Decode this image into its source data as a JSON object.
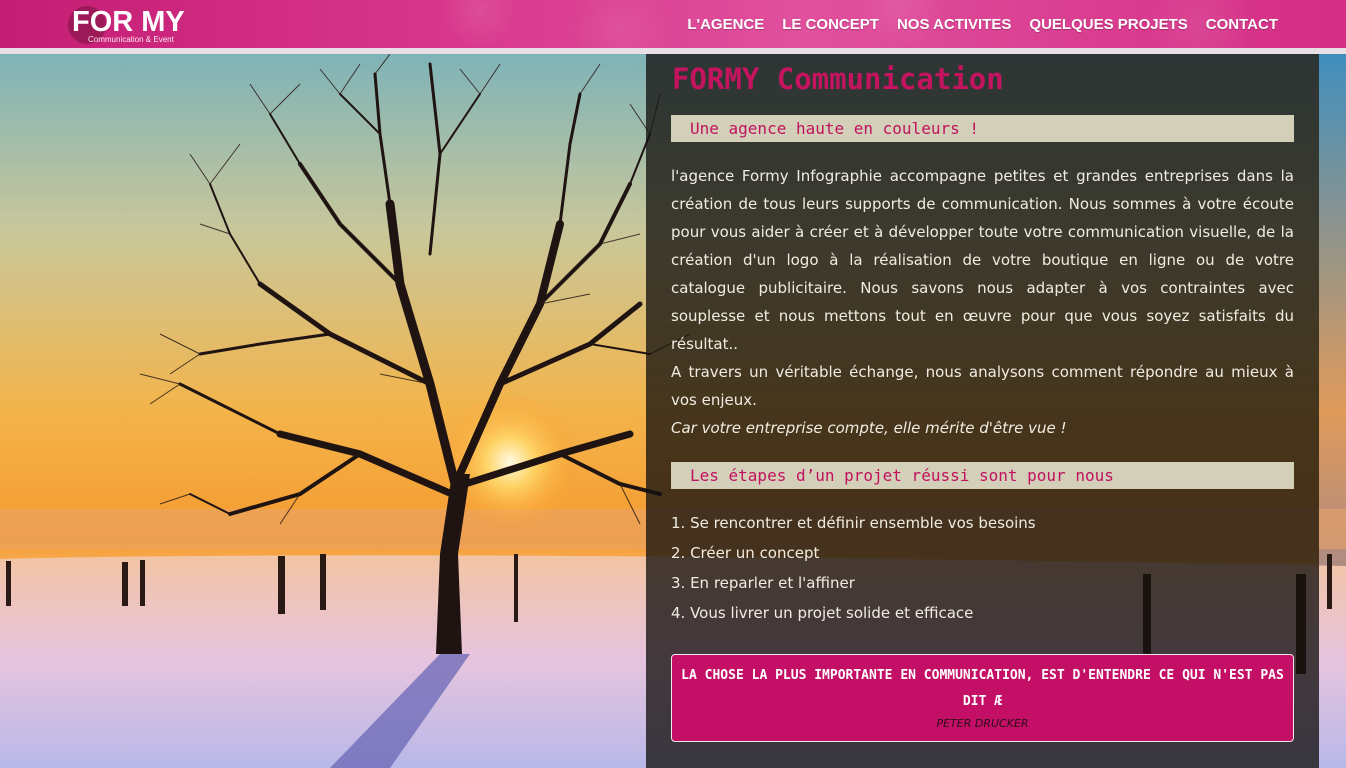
{
  "header": {
    "logo_text": "FOR MY",
    "logo_subtitle": "Communication & Event",
    "nav": [
      {
        "label": "L'AGENCE"
      },
      {
        "label": "LE CONCEPT"
      },
      {
        "label": "NOS ACTIVITES"
      },
      {
        "label": "QUELQUES PROJETS"
      },
      {
        "label": "CONTACT"
      }
    ]
  },
  "main": {
    "title": "FORMY Communication",
    "section1_heading": "Une agence haute en couleurs !",
    "paragraph1": "l'agence Formy Infographie accompagne petites et grandes entreprises dans la création de tous leurs supports de communication. Nous sommes à votre écoute pour vous aider à créer et à développer toute votre communication visuelle, de la création d'un logo à la réalisation de votre boutique en ligne ou de votre catalogue publicitaire. Nous savons nous adapter à vos contraintes avec souplesse et nous mettons tout en œuvre pour que vous soyez satisfaits du résultat..",
    "paragraph2": "A travers un véritable échange, nous analysons comment répondre au mieux à vos enjeux.",
    "tagline": "Car votre entreprise compte, elle mérite d'être vue !",
    "section2_heading": "Les étapes d’un projet réussi sont pour nous",
    "steps": [
      "1. Se rencontrer et définir ensemble vos besoins",
      "2. Créer un concept",
      "3. En reparler et l'affiner",
      "4. Vous livrer un projet solide et efficace"
    ],
    "quote": {
      "text": "LA CHOSE LA PLUS IMPORTANTE EN COMMUNICATION, EST D'ENTENDRE CE QUI N'EST PAS DIT Æ",
      "author": "PETER DRUCKER"
    }
  },
  "colors": {
    "header_pink": "#d42d85",
    "accent_magenta": "#c4145f",
    "subhead_bg": "#d4cfb8",
    "quote_bg": "#c40f66"
  }
}
